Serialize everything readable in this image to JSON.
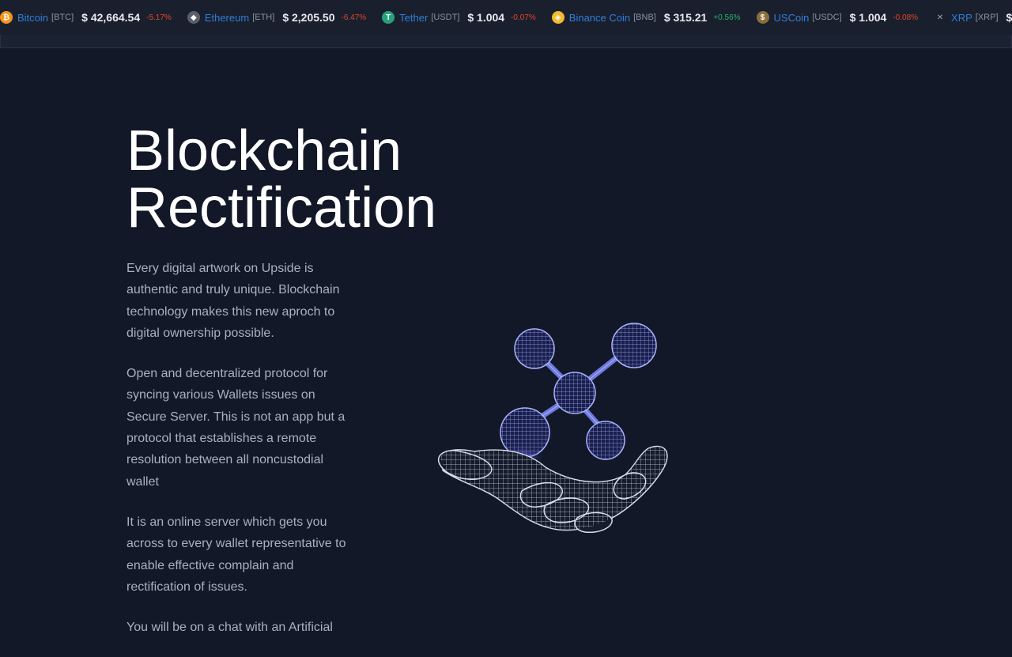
{
  "ticker": {
    "coins": [
      {
        "name": "Bitcoin",
        "symbol": "[BTC]",
        "price": "$ 42,664.54",
        "change": "-5.17%",
        "direction": "neg",
        "icon": "bitcoin-icon",
        "color": "#f7931a",
        "glyph": "₿"
      },
      {
        "name": "Ethereum",
        "symbol": "[ETH]",
        "price": "$ 2,205.50",
        "change": "-6.47%",
        "direction": "neg",
        "icon": "ethereum-icon",
        "color": "#5b5f6b",
        "glyph": "◆"
      },
      {
        "name": "Tether",
        "symbol": "[USDT]",
        "price": "$ 1.004",
        "change": "-0.07%",
        "direction": "neg",
        "icon": "tether-icon",
        "color": "#26a17b",
        "glyph": "T"
      },
      {
        "name": "Binance Coin",
        "symbol": "[BNB]",
        "price": "$ 315.21",
        "change": "+0.56%",
        "direction": "pos",
        "icon": "binance-icon",
        "color": "#f3ba2f",
        "glyph": "◈"
      },
      {
        "name": "USCoin",
        "symbol": "[USDC]",
        "price": "$ 1.004",
        "change": "-0.08%",
        "direction": "neg",
        "icon": "uscoin-icon",
        "color": "#8a6d3b",
        "glyph": "$"
      },
      {
        "name": "XRP",
        "symbol": "[XRP]",
        "price": "$",
        "change": "",
        "direction": "neg",
        "icon": "xrp-icon",
        "color": "transparent",
        "glyph": "✕"
      }
    ]
  },
  "hero": {
    "title_line1": "Blockchain",
    "title_line2": "Rectification"
  },
  "body": {
    "paragraphs": [
      "Every digital artwork on Upside is authentic and truly unique. Blockchain technology makes this new aproch to digital ownership possible.",
      "Open and decentralized protocol for syncing various Wallets issues on Secure Server. This is not an app but a protocol that establishes a remote resolution between all noncustodial wallet",
      "It is an online server which gets you across to every wallet representative to enable effective complain and rectification of issues.",
      "You will be on a chat with an Artificial"
    ]
  },
  "illustration": {
    "icon": "hand-holding-molecule-icon"
  },
  "colors": {
    "background": "#121827",
    "ticker_background": "#1a1f2d",
    "link_blue": "#2f7fd8",
    "negative": "#e2472d",
    "positive": "#26b26b",
    "wireframe_blue": "#6f7dff"
  }
}
